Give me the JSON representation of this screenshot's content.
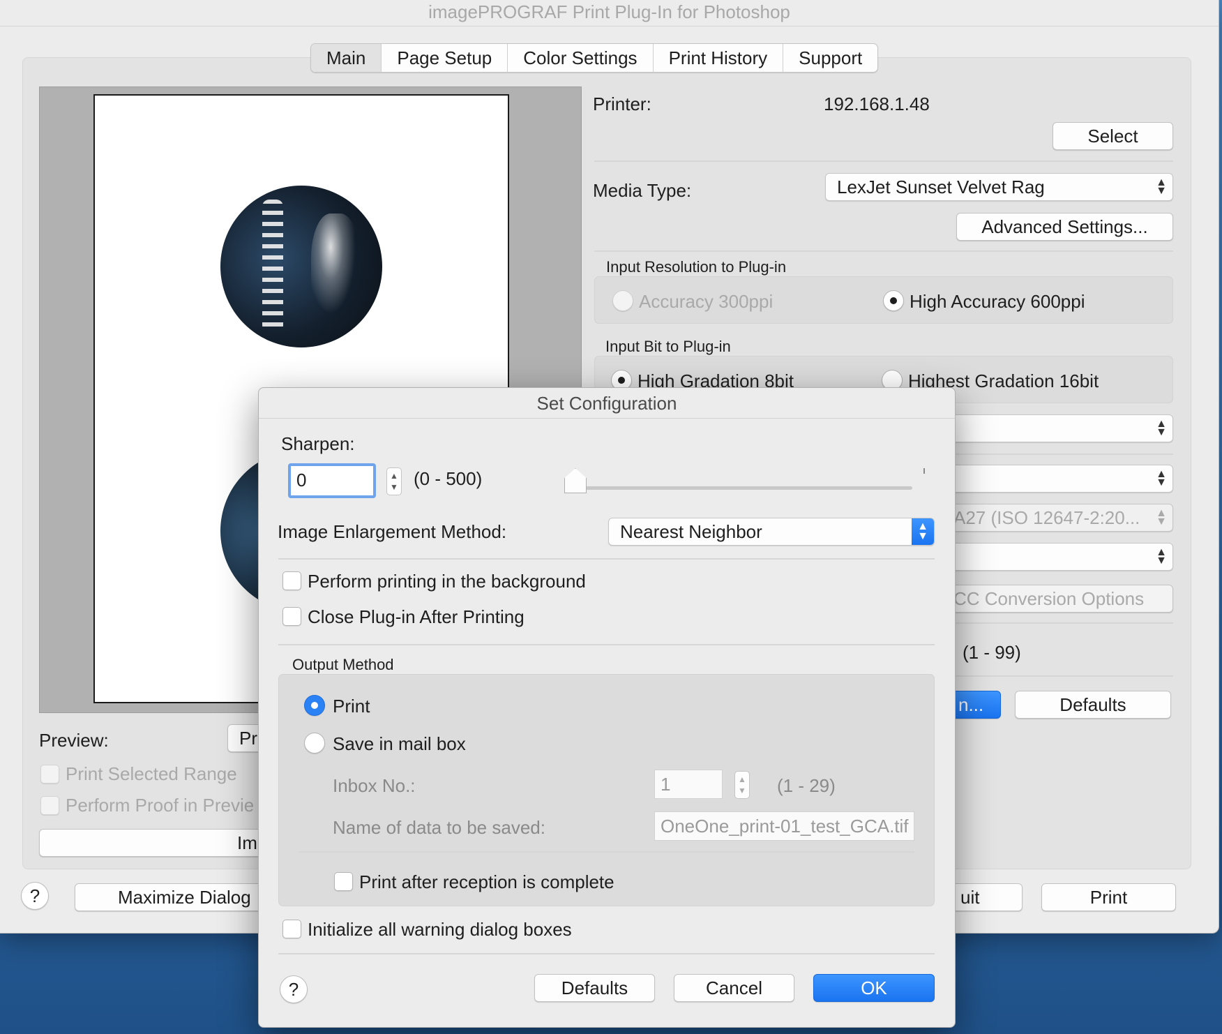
{
  "window": {
    "title": "imagePROGRAF Print Plug-In for Photoshop"
  },
  "tabs": [
    {
      "label": "Main",
      "active": true
    },
    {
      "label": "Page Setup",
      "active": false
    },
    {
      "label": "Color Settings",
      "active": false
    },
    {
      "label": "Print History",
      "active": false
    },
    {
      "label": "Support",
      "active": false
    }
  ],
  "main": {
    "printer_label": "Printer:",
    "printer_value": "192.168.1.48",
    "select_button": "Select",
    "media_type_label": "Media Type:",
    "media_type_value": "LexJet Sunset Velvet Rag",
    "advanced_settings_button": "Advanced Settings...",
    "input_resolution_group": "Input Resolution to Plug-in",
    "accuracy_300": "Accuracy 300ppi",
    "accuracy_600": "High Accuracy 600ppi",
    "input_bit_group": "Input Bit to Plug-in",
    "bit_8": "High Gradation 8bit",
    "bit_16": "Highest Gradation 16bit",
    "profile_partial": "A27 (ISO 12647-2:20...",
    "icc_options_partial": "CC Conversion Options",
    "copies_range": "(1 - 99)",
    "config_button_partial": "n...",
    "defaults_button": "Defaults",
    "preview_label": "Preview:",
    "preview_button_partial": "Pr",
    "print_selected_range": "Print Selected Range",
    "perform_proof_partial": "Perform Proof in Previe",
    "bottom_partial_button": "Im",
    "help_icon": "?",
    "maximize_button_partial": "Maximize Dialog",
    "quit_button_partial": "uit",
    "print_button": "Print"
  },
  "dialog": {
    "title": "Set Configuration",
    "sharpen_label": "Sharpen:",
    "sharpen_value": "0",
    "sharpen_range": "(0 - 500)",
    "sharpen_level": 0,
    "enlargement_label": "Image Enlargement Method:",
    "enlargement_value": "Nearest Neighbor",
    "perform_background": "Perform printing in the background",
    "close_after_print": "Close Plug-in After Printing",
    "output_method_group": "Output Method",
    "output_print": "Print",
    "output_mailbox": "Save in mail box",
    "inbox_label": "Inbox No.:",
    "inbox_value": "1",
    "inbox_range": "(1 - 29)",
    "data_name_label": "Name of data to be saved:",
    "data_name_value": "OneOne_print-01_test_GCA.tif",
    "print_after_reception": "Print after reception is complete",
    "initialize_warnings": "Initialize all warning dialog boxes",
    "help_icon": "?",
    "defaults_button": "Defaults",
    "cancel_button": "Cancel",
    "ok_button": "OK"
  }
}
